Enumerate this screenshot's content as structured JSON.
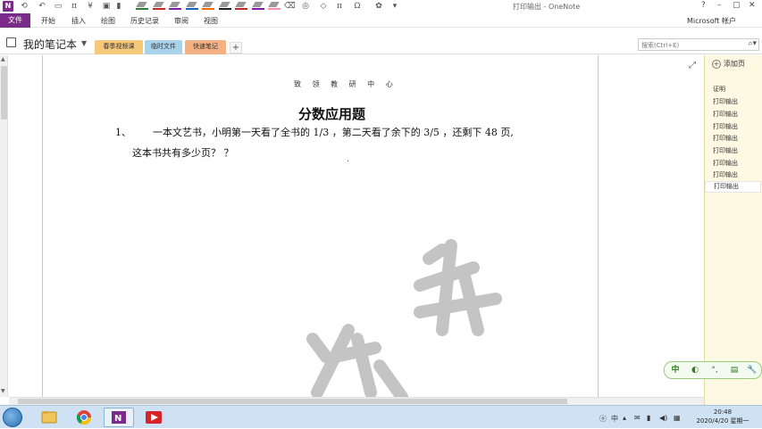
{
  "window": {
    "title": "打印输出 - OneNote",
    "account": "Microsoft 帐户"
  },
  "ribbon": {
    "tabs": [
      "文件",
      "开始",
      "插入",
      "绘图",
      "历史记录",
      "审阅",
      "视图"
    ]
  },
  "quick_access": {
    "pen_colors": [
      "#2e7d32",
      "#c62828",
      "#7b1fa2",
      "#1565c0",
      "#ef6c00",
      "#212121",
      "#c62828",
      "#7b1fa2",
      "#f48fb1"
    ]
  },
  "notebook": {
    "name": "我的笔记本",
    "sections": [
      {
        "label": "春季视频课",
        "color": "#f6c87a"
      },
      {
        "label": "临时文件",
        "color": "#a9d3ea"
      },
      {
        "label": "快速笔记",
        "color": "#f4b183"
      }
    ],
    "add_section": "+"
  },
  "search": {
    "placeholder": "搜索(Ctrl+E)"
  },
  "page": {
    "header": "致 领 教 研 中 心",
    "title": "分数应用题",
    "question_number": "1、",
    "question_line1": "一本文艺书，小明第一天看了全书的 1/3 ，第二天看了余下的 3/5 ，还剩下 48 页,",
    "question_line2": "这本书共有多少页？  ？",
    "watermark": "教研"
  },
  "page_panel": {
    "add_page": "添加页",
    "pages": [
      "证明",
      "打印输出",
      "打印输出",
      "打印输出",
      "打印输出",
      "打印输出",
      "打印输出",
      "打印输出",
      "打印输出"
    ],
    "selected_index": 8
  },
  "input_method": {
    "items": [
      "中",
      "◐",
      "°,",
      "▤",
      "🔧"
    ]
  },
  "taskbar": {
    "time": "20:48",
    "date": "2020/4/20 星期一",
    "tray_lang": "中"
  }
}
